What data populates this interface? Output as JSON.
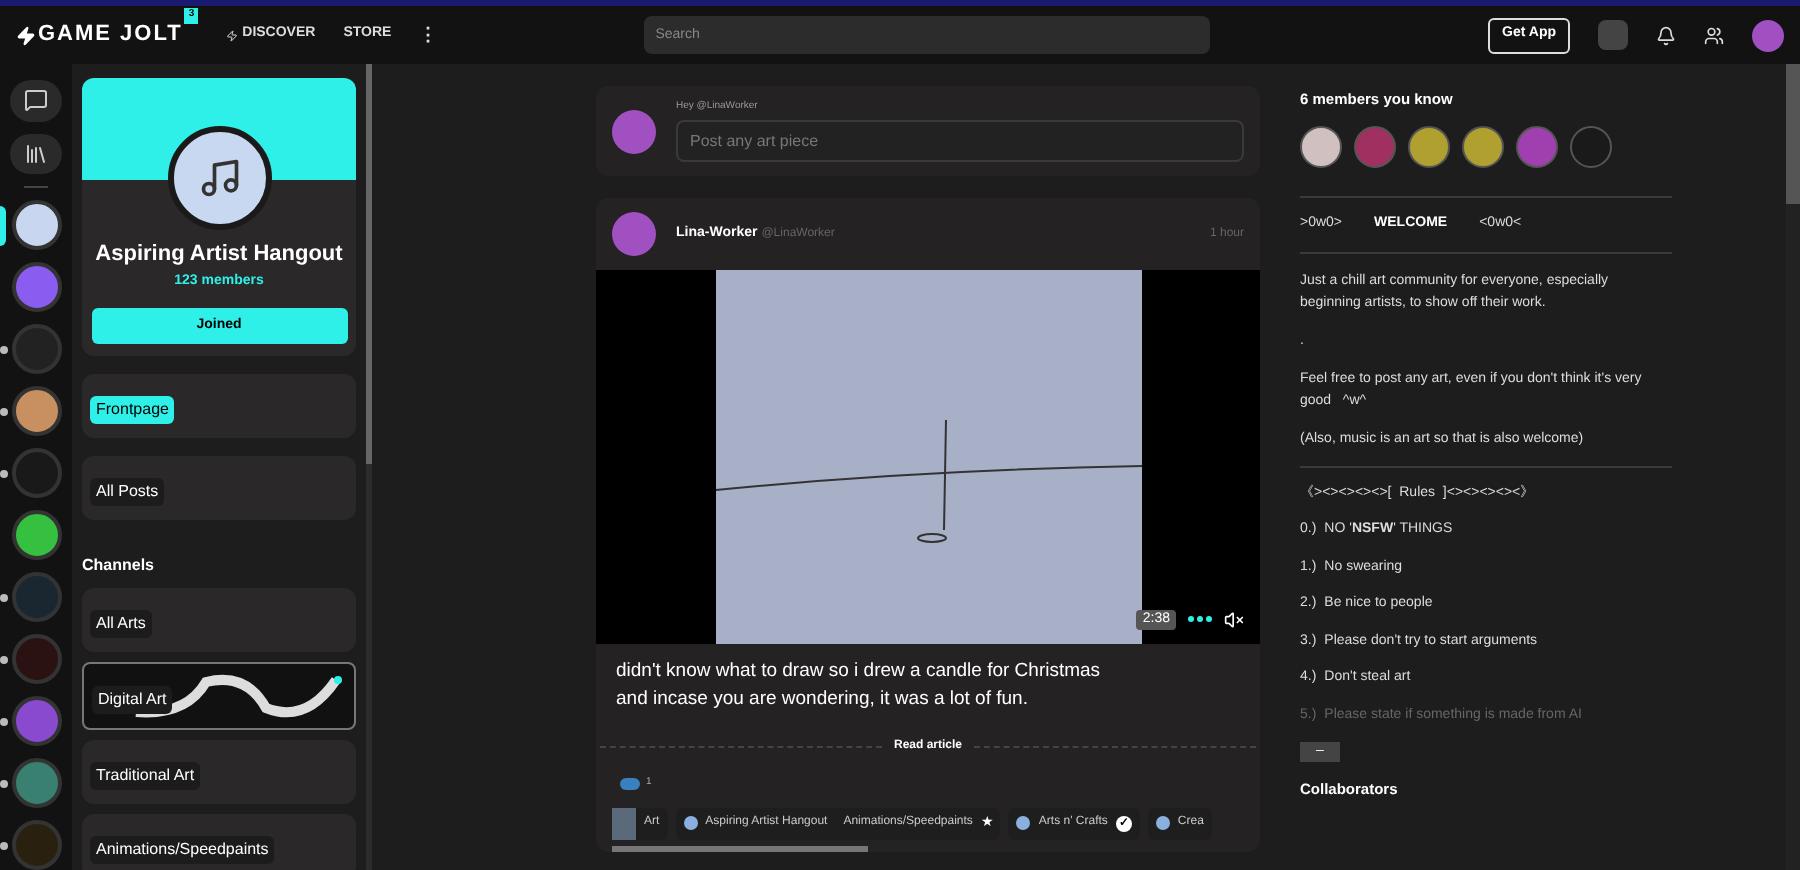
{
  "topbar": {
    "logo": "GAME JOLT",
    "badge": "3",
    "nav": [
      {
        "label": "DISCOVER",
        "kind": "icon"
      },
      {
        "label": "STORE",
        "kind": "plain"
      }
    ],
    "more": "⋮",
    "search": {
      "placeholder": "Search"
    },
    "get_app": "Get App"
  },
  "rail": {
    "communities": [
      {
        "selected": true,
        "unread": false
      },
      {
        "selected": false,
        "unread": false
      },
      {
        "selected": false,
        "unread": true
      },
      {
        "selected": false,
        "unread": true
      },
      {
        "selected": false,
        "unread": true
      },
      {
        "selected": false,
        "unread": false
      },
      {
        "selected": false,
        "unread": true
      },
      {
        "selected": false,
        "unread": true
      },
      {
        "selected": false,
        "unread": true
      },
      {
        "selected": false,
        "unread": true
      },
      {
        "selected": false,
        "unread": true
      }
    ]
  },
  "community": {
    "name": "Aspiring Artist Hangout",
    "member_count": "123",
    "members_label": "members",
    "join_button": "Joined",
    "pages": [
      {
        "label": "Frontpage",
        "selected": true
      },
      {
        "label": "All Posts",
        "selected": false
      }
    ],
    "channels_heading": "Channels",
    "channels": [
      {
        "label": "All Arts",
        "kind": "plain"
      },
      {
        "label": "Digital Art",
        "kind": "image"
      },
      {
        "label": "Traditional Art",
        "kind": "plain"
      },
      {
        "label": "Animations/Speedpaints",
        "kind": "plain"
      }
    ]
  },
  "composer": {
    "greeting": "Hey @LinaWorker",
    "placeholder": "Post any art piece"
  },
  "post": {
    "author": "Lina-Worker",
    "handle": "@LinaWorker",
    "time": "1 hour",
    "video": {
      "duration": "2:38",
      "muted": true
    },
    "text": "didn't know what to draw so i drew a candle for Christmas\nand incase you are wondering, it was a lot of fun.",
    "read_more": "Read article",
    "reactions": [
      {
        "count": "1"
      }
    ],
    "tags": [
      {
        "label": "Art",
        "kind": "game"
      },
      {
        "label": "Aspiring Artist Hangout",
        "kind": "community",
        "channel": "Animations/Speedpaints",
        "badge": "★"
      },
      {
        "label": "Arts n' Crafts",
        "kind": "community",
        "badge": "✓"
      },
      {
        "label": "Crea",
        "kind": "community"
      }
    ]
  },
  "sidebar": {
    "members_heading": "6 members you know",
    "welcome": [
      ">0w0>",
      "WELCOME",
      "<0w0<"
    ],
    "paragraphs": [
      "Just a chill art community for everyone, especially beginning artists, to show off their work.",
      ".",
      "Feel free to post any art, even if you don't think it's very good   ^w^",
      "(Also, music is an art so that is also welcome)"
    ],
    "rules_heading": "《><><><><>[  Rules  ]<><><><><》",
    "rules": [
      {
        "number": "0.)",
        "text": "NO '**NSFW**' THINGS",
        "faded": false
      },
      {
        "number": "1.)",
        "text": "No swearing",
        "faded": false
      },
      {
        "number": "2.)",
        "text": "Be nice to people",
        "faded": false
      },
      {
        "number": "3.)",
        "text": "Please don't try to start arguments",
        "faded": false
      },
      {
        "number": "4.)",
        "text": "Don't steal art",
        "faded": false
      },
      {
        "number": "5.)",
        "text": "Please state if something is made from AI",
        "faded": true
      }
    ],
    "collapse": "–",
    "collaborators_heading": "Collaborators"
  }
}
